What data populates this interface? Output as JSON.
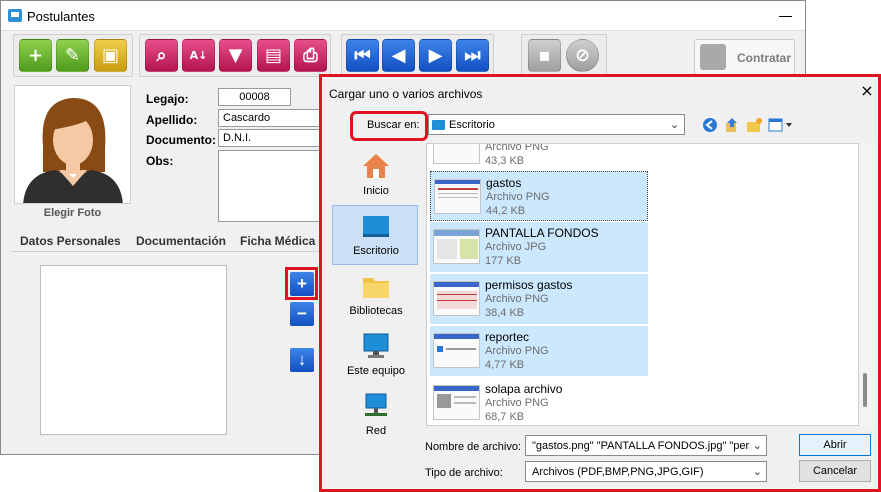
{
  "main_window": {
    "title": "Postulantes",
    "contratar_label": "Contratar",
    "photo_label": "Elegir Foto",
    "fields": {
      "legajo_label": "Legajo:",
      "legajo_value": "00008",
      "apellido_label": "Apellido:",
      "apellido_value": "Cascardo",
      "documento_label": "Documento:",
      "documento_value": "D.N.I.",
      "obs_label": "Obs:"
    },
    "tabs": [
      "Datos Personales",
      "Documentación",
      "Ficha Médica"
    ]
  },
  "dialog": {
    "title": "Cargar uno o varios archivos",
    "look_in_label": "Buscar en:",
    "look_in_value": "Escritorio",
    "places": [
      {
        "label": "Inicio",
        "icon": "home-icon"
      },
      {
        "label": "Escritorio",
        "icon": "desktop-icon",
        "selected": true
      },
      {
        "label": "Bibliotecas",
        "icon": "libraries-icon"
      },
      {
        "label": "Este equipo",
        "icon": "computer-icon"
      },
      {
        "label": "Red",
        "icon": "network-icon"
      }
    ],
    "files": [
      {
        "name": "",
        "type": "Archivo PNG",
        "size": "43,3 KB",
        "selected": false
      },
      {
        "name": "gastos",
        "type": "Archivo PNG",
        "size": "44,2 KB",
        "selected": true,
        "focus": true
      },
      {
        "name": "PANTALLA FONDOS",
        "type": "Archivo JPG",
        "size": "177 KB",
        "selected": true
      },
      {
        "name": "permisos gastos",
        "type": "Archivo PNG",
        "size": "38,4 KB",
        "selected": true
      },
      {
        "name": "reportec",
        "type": "Archivo PNG",
        "size": "4,77 KB",
        "selected": true
      },
      {
        "name": "solapa archivo",
        "type": "Archivo PNG",
        "size": "68,7 KB",
        "selected": false
      }
    ],
    "filename_label": "Nombre de archivo:",
    "filename_value": "\"gastos.png\" \"PANTALLA FONDOS.jpg\" \"per",
    "filetype_label": "Tipo de archivo:",
    "filetype_value": "Archivos (PDF,BMP,PNG,JPG,GIF)",
    "open_button": "Abrir",
    "cancel_button": "Cancelar"
  },
  "colors": {
    "highlight_red": "#e01420",
    "selection_blue": "#cce8ff",
    "green_button": "#6cbb34",
    "pink_button": "#d0246a",
    "blue_button": "#1f63d6"
  }
}
